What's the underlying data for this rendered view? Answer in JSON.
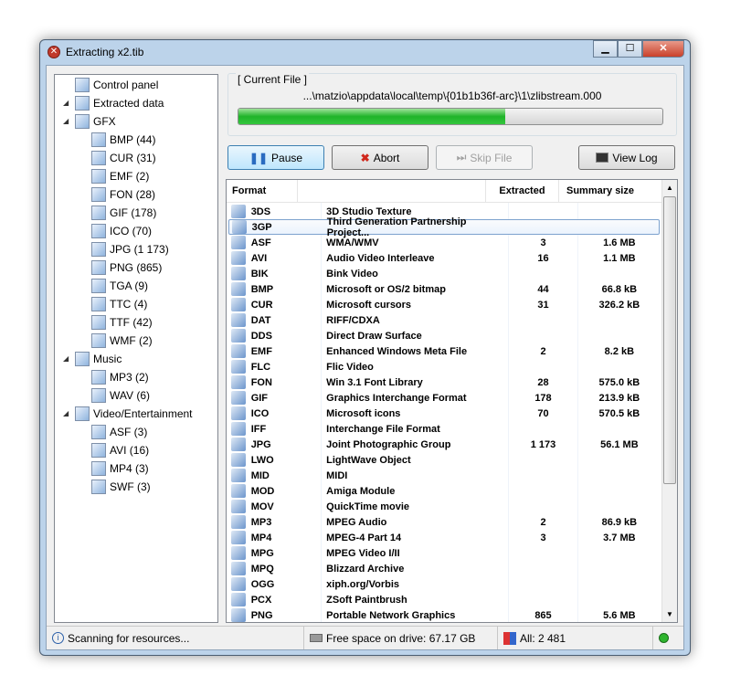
{
  "window": {
    "title": "Extracting x2.tib",
    "minimize": "▁",
    "maximize": "☐",
    "close": "✕"
  },
  "tree": [
    {
      "label": "Control panel",
      "level": 0
    },
    {
      "label": "Extracted data",
      "level": 0,
      "expanded": true
    },
    {
      "label": "GFX",
      "level": 1,
      "expanded": true
    },
    {
      "label": "BMP (44)",
      "level": 2
    },
    {
      "label": "CUR (31)",
      "level": 2
    },
    {
      "label": "EMF (2)",
      "level": 2
    },
    {
      "label": "FON (28)",
      "level": 2
    },
    {
      "label": "GIF (178)",
      "level": 2
    },
    {
      "label": "ICO (70)",
      "level": 2
    },
    {
      "label": "JPG (1 173)",
      "level": 2
    },
    {
      "label": "PNG (865)",
      "level": 2
    },
    {
      "label": "TGA (9)",
      "level": 2
    },
    {
      "label": "TTC (4)",
      "level": 2
    },
    {
      "label": "TTF (42)",
      "level": 2
    },
    {
      "label": "WMF (2)",
      "level": 2
    },
    {
      "label": "Music",
      "level": 1,
      "expanded": true
    },
    {
      "label": "MP3 (2)",
      "level": 2
    },
    {
      "label": "WAV (6)",
      "level": 2
    },
    {
      "label": "Video/Entertainment",
      "level": 1,
      "expanded": true
    },
    {
      "label": "ASF (3)",
      "level": 2
    },
    {
      "label": "AVI (16)",
      "level": 2
    },
    {
      "label": "MP4 (3)",
      "level": 2
    },
    {
      "label": "SWF (3)",
      "level": 2
    }
  ],
  "current_file": {
    "label": "[ Current File ]",
    "path": "...\\matzio\\appdata\\local\\temp\\{01b1b36f-arc}\\1\\zlibstream.000",
    "progress": 0.63,
    "progress_color": "#22b52c"
  },
  "buttons": {
    "pause": "Pause",
    "abort": "Abort",
    "skip": "Skip File",
    "view_log": "View Log"
  },
  "table": {
    "columns": [
      "Format",
      "",
      "Extracted",
      "Summary size"
    ],
    "rows": [
      [
        "3DS",
        "3D Studio Texture",
        "",
        ""
      ],
      [
        "3GP",
        "Third Generation Partnership Project...",
        "",
        ""
      ],
      [
        "ASF",
        "WMA/WMV",
        "3",
        "1.6 MB"
      ],
      [
        "AVI",
        "Audio Video Interleave",
        "16",
        "1.1 MB"
      ],
      [
        "BIK",
        "Bink Video",
        "",
        ""
      ],
      [
        "BMP",
        "Microsoft or OS/2 bitmap",
        "44",
        "66.8 kB"
      ],
      [
        "CUR",
        "Microsoft cursors",
        "31",
        "326.2 kB"
      ],
      [
        "DAT",
        "RIFF/CDXA",
        "",
        ""
      ],
      [
        "DDS",
        "Direct Draw Surface",
        "",
        ""
      ],
      [
        "EMF",
        "Enhanced Windows Meta File",
        "2",
        "8.2 kB"
      ],
      [
        "FLC",
        "Flic Video",
        "",
        ""
      ],
      [
        "FON",
        "Win 3.1 Font Library",
        "28",
        "575.0 kB"
      ],
      [
        "GIF",
        "Graphics Interchange Format",
        "178",
        "213.9 kB"
      ],
      [
        "ICO",
        "Microsoft icons",
        "70",
        "570.5 kB"
      ],
      [
        "IFF",
        "Interchange File Format",
        "",
        ""
      ],
      [
        "JPG",
        "Joint Photographic Group",
        "1 173",
        "56.1 MB"
      ],
      [
        "LWO",
        "LightWave Object",
        "",
        ""
      ],
      [
        "MID",
        "MIDI",
        "",
        ""
      ],
      [
        "MOD",
        "Amiga Module",
        "",
        ""
      ],
      [
        "MOV",
        "QuickTime movie",
        "",
        ""
      ],
      [
        "MP3",
        "MPEG Audio",
        "2",
        "86.9 kB"
      ],
      [
        "MP4",
        "MPEG-4 Part 14",
        "3",
        "3.7 MB"
      ],
      [
        "MPG",
        "MPEG Video I/II",
        "",
        ""
      ],
      [
        "MPQ",
        "Blizzard Archive",
        "",
        ""
      ],
      [
        "OGG",
        "xiph.org/Vorbis",
        "",
        ""
      ],
      [
        "PCX",
        "ZSoft Paintbrush",
        "",
        ""
      ],
      [
        "PNG",
        "Portable Network Graphics",
        "865",
        "5.6 MB"
      ]
    ],
    "selected_row": 1
  },
  "status": {
    "scanning": "Scanning for resources...",
    "free_space": "Free space on drive: 67.17 GB",
    "all": "All: 2 481",
    "indicator_color": "#2fb52f"
  }
}
